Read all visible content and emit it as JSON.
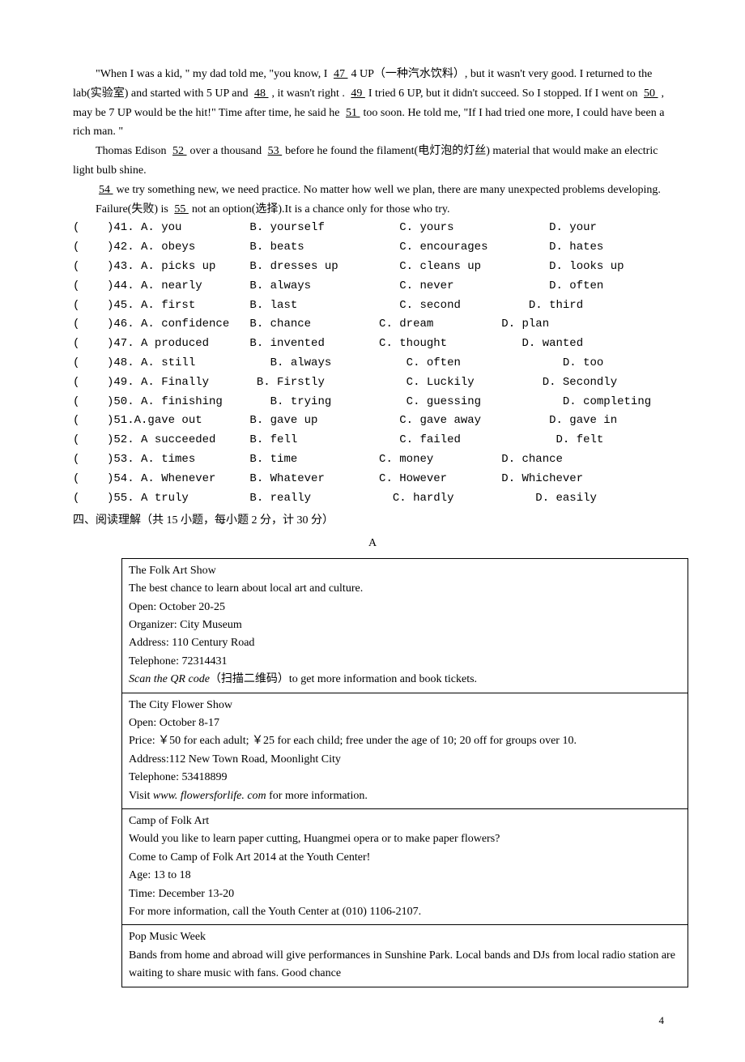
{
  "passage": {
    "p1": "\"When I was a kid, \" my dad told me, \"you know, I ",
    "b47": "  47 ",
    "p1b": " 4 UP（一种汽水饮料）, but it wasn't very good. I returned to the lab(实验室) and started with 5 UP and ",
    "b48": "  48  ",
    "p1c": ", it wasn't right . ",
    "b49": " 49 ",
    "p1d": " I tried 6 UP, but it didn't succeed. So I stopped. If I went on ",
    "b50": " 50  ",
    "p1e": ", may be 7 UP would be the hit!\" Time after time, he said he ",
    "b51": " 51  ",
    "p1f": " too soon. He told me, \"If I had tried one more, I could have been a rich man. \"",
    "p2a": "Thomas Edison ",
    "b52": " 52  ",
    "p2b": "over a thousand  ",
    "b53": " 53  ",
    "p2c": "before he found the filament(电灯泡的灯丝) material that would make an electric light bulb shine.",
    "p3a": "",
    "b54": " 54  ",
    "p3b": " we try something new, we need practice. No matter how well we plan, there are many unexpected problems developing.",
    "p4a": "Failure(失败) is ",
    "b55": "  55  ",
    "p4b": " not an option(选择).It is a chance only for those who try."
  },
  "questions": [
    {
      "n": "41",
      "a": "A. you",
      "b": "B. yourself",
      "c": "C. yours",
      "d": "D. your"
    },
    {
      "n": "42",
      "a": "A. obeys",
      "b": "B. beats",
      "c": "C. encourages",
      "d": "D. hates"
    },
    {
      "n": "43",
      "a": "A. picks up",
      "b": "B. dresses up",
      "c": "C. cleans up",
      "d": "D. looks up"
    },
    {
      "n": "44",
      "a": "A. nearly",
      "b": "B. always",
      "c": "C. never",
      "d": "D. often"
    },
    {
      "n": "45",
      "a": "A. first",
      "b": "B. last",
      "c": "C. second",
      "d": "D. third"
    },
    {
      "n": "46",
      "a": "A. confidence",
      "b": "B. chance",
      "c": "C. dream",
      "d": "D. plan"
    },
    {
      "n": "47",
      "a": "A produced",
      "b": "B. invented",
      "c": "C. thought",
      "d": "D. wanted"
    },
    {
      "n": "48",
      "a": "A. still",
      "b": "B. always",
      "c": "C. often",
      "d": "D. too"
    },
    {
      "n": "49",
      "a": "A. Finally",
      "b": "B. Firstly",
      "c": "C. Luckily",
      "d": "D. Secondly"
    },
    {
      "n": "50",
      "a": "A. finishing",
      "b": "B. trying",
      "c": "C. guessing",
      "d": "D. completing"
    },
    {
      "n": "51",
      "a": "A.gave out",
      "b": "B. gave up",
      "c": "C. gave away",
      "d": "D. gave in"
    },
    {
      "n": "52",
      "a": "A succeeded",
      "b": "B. fell",
      "c": "C. failed",
      "d": "D. felt"
    },
    {
      "n": "53",
      "a": "A. times",
      "b": "B. time",
      "c": "C. money",
      "d": "D. chance"
    },
    {
      "n": "54",
      "a": "A. Whenever",
      "b": "B. Whatever",
      "c": "C. However",
      "d": "D. Whichever"
    },
    {
      "n": "55",
      "a": "A truly",
      "b": "B. really",
      "c": "C. hardly",
      "d": "D. easily"
    }
  ],
  "q41": "(    )41. A. you          B. yourself           C. yours              D. your",
  "q42": "(    )42. A. obeys        B. beats              C. encourages         D. hates",
  "q43": "(    )43. A. picks up     B. dresses up         C. cleans up          D. looks up",
  "q44": "(    )44. A. nearly       B. always             C. never              D. often",
  "q45": "(    )45. A. first        B. last               C. second          D. third",
  "q46": "(    )46. A. confidence   B. chance          C. dream          D. plan",
  "q47": "(    )47. A produced      B. invented        C. thought           D. wanted",
  "q48": "(    )48. A. still           B. always           C. often               D. too",
  "q49": "(    )49. A. Finally       B. Firstly            C. Luckily          D. Secondly",
  "q50": "(    )50. A. finishing       B. trying           C. guessing            D. completing",
  "q51": "(    )51.A.gave out       B. gave up            C. gave away          D. gave in",
  "q52": "(    )52. A succeeded     B. fell               C. failed              D. felt",
  "q53": "(    )53. A. times        B. time            C. money          D. chance",
  "q54": "(    )54. A. Whenever     B. Whatever        C. However        D. Whichever",
  "q55": "(    )55. A truly         B. really            C. hardly            D. easily",
  "section4_title": "四、阅读理解（共 15 小题，每小题 2 分，计 30 分）",
  "labelA": "A",
  "ads": {
    "row1": {
      "l1": "The Folk Art Show",
      "l2": "The best chance to learn about local art and culture.",
      "l3": "Open: October 20-25",
      "l4": "Organizer: City Museum",
      "l5": "Address: 110 Century Road",
      "l6": "Telephone: 72314431",
      "l7a": "Scan the QR code",
      "l7b": "（扫描二维码）to get more information and book tickets."
    },
    "row2": {
      "l1": "The City Flower Show",
      "l2": "Open: October 8-17",
      "l3": "Price: ￥50 for each adult; ￥25 for each child; free under the age of 10; 20 off for groups over 10.",
      "l4": "Address:112 New Town Road, Moonlight City",
      "l5": "Telephone: 53418899",
      "l6a": "Visit ",
      "l6b": "www. flowersforlife. com",
      "l6c": " for more information."
    },
    "row3": {
      "l1": "Camp of Folk Art",
      "l2": "Would you like to learn paper cutting, Huangmei opera or to make paper flowers?",
      "l3": "Come to Camp of Folk Art 2014 at the Youth Center!",
      "l4": "Age: 13 to 18",
      "l5": "Time: December 13-20",
      "l6": "For more information, call the Youth Center at (010) 1106-2107."
    },
    "row4": {
      "l1": "Pop Music Week",
      "l2": "Bands from home and abroad will give performances in Sunshine Park. Local bands and DJs from local radio station are waiting to share music with fans. Good chance"
    }
  },
  "page_number": "4"
}
